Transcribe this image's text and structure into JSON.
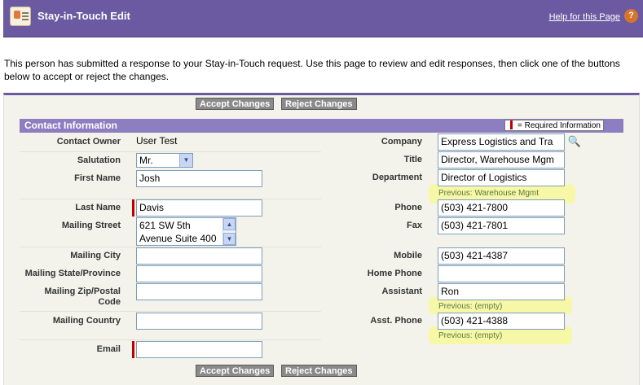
{
  "header": {
    "title": "Stay-in-Touch Edit",
    "help_link": "Help for this Page",
    "help_icon": "?"
  },
  "intro_text": "This person has submitted a response to your Stay-in-Touch request. Use this page to review and edit responses, then click one of the buttons below to accept or reject the changes.",
  "buttons": {
    "accept": "Accept Changes",
    "reject": "Reject Changes"
  },
  "section": {
    "title": "Contact Information",
    "required_legend": "= Required Information"
  },
  "left_fields": {
    "contact_owner": {
      "label": "Contact Owner",
      "value": "User Test"
    },
    "salutation": {
      "label": "Salutation",
      "value": "Mr."
    },
    "first_name": {
      "label": "First Name",
      "value": "Josh"
    },
    "last_name": {
      "label": "Last Name",
      "value": "Davis"
    },
    "mailing_street": {
      "label": "Mailing Street",
      "line1": "621 SW 5th",
      "line2": "Avenue Suite 400"
    },
    "mailing_city": {
      "label": "Mailing City",
      "value": ""
    },
    "mailing_state": {
      "label": "Mailing State/Province",
      "value": ""
    },
    "mailing_zip": {
      "label_line1": "Mailing Zip/Postal",
      "label_line2": "Code",
      "value": ""
    },
    "mailing_country": {
      "label": "Mailing Country",
      "value": ""
    },
    "email": {
      "label": "Email",
      "value": ""
    }
  },
  "right_fields": {
    "company": {
      "label": "Company",
      "value": "Express Logistics and Tra"
    },
    "title": {
      "label": "Title",
      "value": "Director, Warehouse Mgm"
    },
    "department": {
      "label": "Department",
      "value": "Director of Logistics",
      "previous": "Previous: Warehouse Mgmt"
    },
    "phone": {
      "label": "Phone",
      "value": "(503) 421-7800"
    },
    "fax": {
      "label": "Fax",
      "value": "(503) 421-7801"
    },
    "mobile": {
      "label": "Mobile",
      "value": "(503) 421-4387"
    },
    "home_phone": {
      "label": "Home Phone",
      "value": ""
    },
    "assistant": {
      "label": "Assistant",
      "value": "Ron",
      "previous": "Previous: (empty)"
    },
    "asst_phone": {
      "label": "Asst. Phone",
      "value": "(503) 421-4388",
      "previous": "Previous: (empty)"
    }
  },
  "colors": {
    "header_bg": "#6b5aa1",
    "section_bg": "#8c7ec0",
    "required": "#c00000",
    "highlight": "#f7f7a8"
  }
}
